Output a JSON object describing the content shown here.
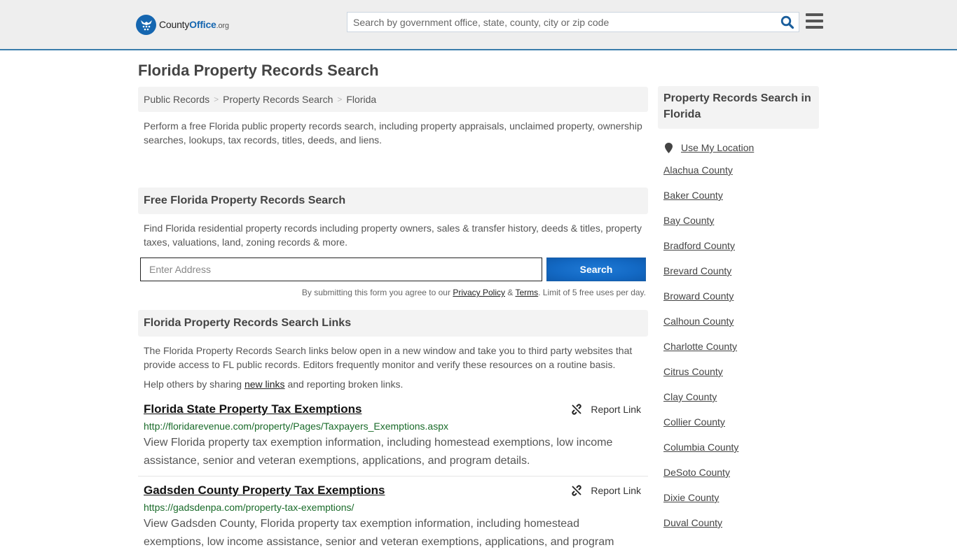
{
  "header": {
    "logo": {
      "name_part1": "County",
      "name_part2": "Office",
      "name_part3": ".org"
    },
    "search_placeholder": "Search by government office, state, county, city or zip code",
    "search_icon": "search-icon",
    "menu_icon": "hamburger-menu-icon"
  },
  "page": {
    "title": "Florida Property Records Search"
  },
  "breadcrumb": [
    {
      "label": "Public Records"
    },
    {
      "label": "Property Records Search"
    },
    {
      "label": "Florida"
    }
  ],
  "breadcrumb_separator": ">",
  "intro": "Perform a free Florida public property records search, including property appraisals, unclaimed property, ownership searches, lookups, tax records, titles, deeds, and liens.",
  "free_search": {
    "heading": "Free Florida Property Records Search",
    "description": "Find Florida residential property records including property owners, sales & transfer history, deeds & titles, property taxes, valuations, land, zoning records & more.",
    "address_placeholder": "Enter Address",
    "button_label": "Search",
    "disclaimer_pre": "By submitting this form you agree to our ",
    "privacy_label": "Privacy Policy",
    "amp": " & ",
    "terms_label": "Terms",
    "disclaimer_post": ". Limit of 5 free uses per day."
  },
  "links_section": {
    "heading": "Florida Property Records Search Links",
    "description": "The Florida Property Records Search links below open in a new window and take you to third party websites that provide access to FL public records. Editors frequently monitor and verify these resources on a routine basis.",
    "help_pre": "Help others by sharing ",
    "help_link": "new links",
    "help_post": " and reporting broken links.",
    "report_label": "Report Link",
    "items": [
      {
        "title": "Florida State Property Tax Exemptions",
        "url": "http://floridarevenue.com/property/Pages/Taxpayers_Exemptions.aspx",
        "body": "View Florida property tax exemption information, including homestead exemptions, low income assistance, senior and veteran exemptions, applications, and program details."
      },
      {
        "title": "Gadsden County Property Tax Exemptions",
        "url": "https://gadsdenpa.com/property-tax-exemptions/",
        "body": "View Gadsden County, Florida property tax exemption information, including homestead exemptions, low income assistance, senior and veteran exemptions, applications, and program"
      }
    ]
  },
  "sidebar": {
    "heading": "Property Records Search in Florida",
    "use_location": "Use My Location",
    "counties": [
      "Alachua County",
      "Baker County",
      "Bay County",
      "Bradford County",
      "Brevard County",
      "Broward County",
      "Calhoun County",
      "Charlotte County",
      "Citrus County",
      "Clay County",
      "Collier County",
      "Columbia County",
      "DeSoto County",
      "Dixie County",
      "Duval County"
    ]
  },
  "colors": {
    "brand_blue": "#1566b0",
    "header_border": "#3a7dab",
    "url_green": "#1a6b2a",
    "button_blue": "#1369c4"
  }
}
